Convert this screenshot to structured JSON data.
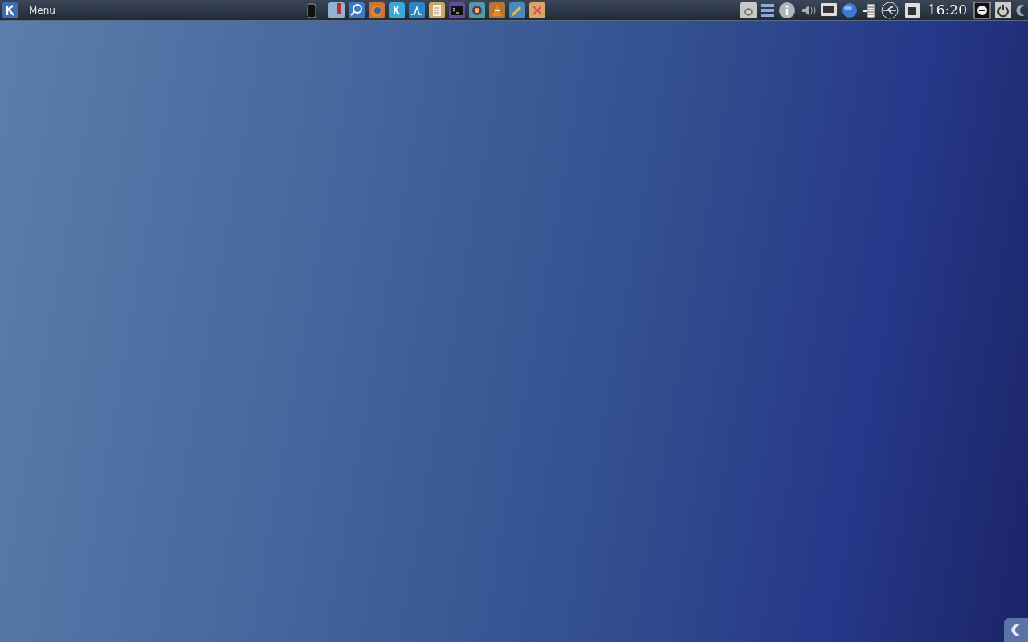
{
  "panel": {
    "menu_label": "Menu",
    "clock": "16:20"
  }
}
